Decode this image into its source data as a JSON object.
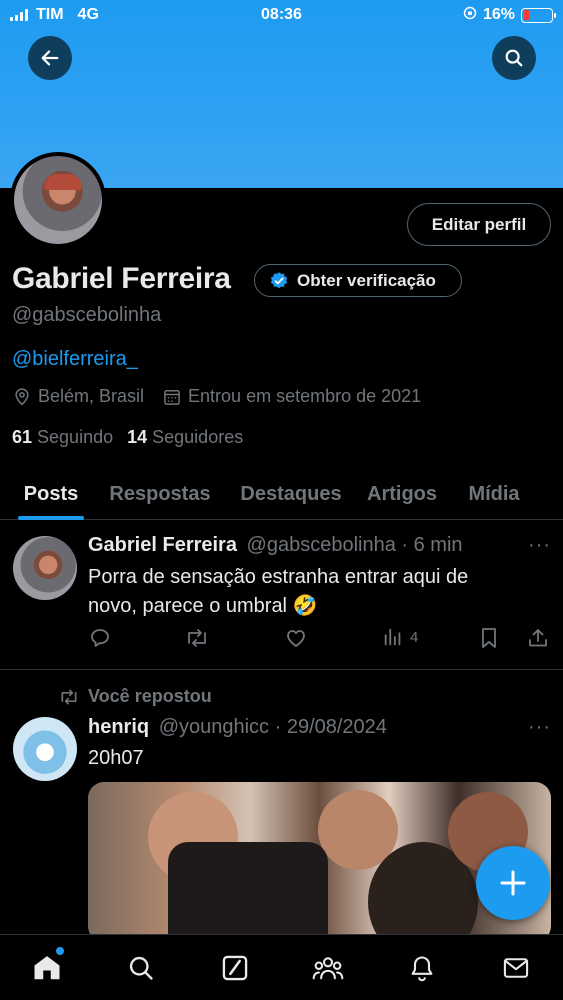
{
  "status_bar": {
    "carrier": "TIM",
    "network": "4G",
    "time": "08:36",
    "battery": "16%"
  },
  "profile": {
    "name": "Gabriel Ferreira",
    "verification_label": "Obter verificação",
    "handle": "@gabscebolinha",
    "bio": "@bielferreira_",
    "location": "Belém, Brasil",
    "joined": "Entrou em setembro de 2021",
    "following_count": "61",
    "following_label": "Seguindo",
    "followers_count": "14",
    "followers_label": "Seguidores",
    "edit_label": "Editar perfil"
  },
  "tabs": [
    {
      "label": "Posts",
      "active": true
    },
    {
      "label": "Respostas",
      "active": false
    },
    {
      "label": "Destaques",
      "active": false
    },
    {
      "label": "Artigos",
      "active": false
    },
    {
      "label": "Mídia",
      "active": false
    }
  ],
  "posts": [
    {
      "author": "Gabriel Ferreira",
      "handle_time": "@gabscebolinha · 6 min",
      "text_line1": "Porra de sensação estranha entrar aqui de",
      "text_line2": "novo, parece o umbral 🤣",
      "views": "4",
      "more": "···"
    },
    {
      "repost_label": "Você repostou",
      "author": "henriq",
      "handle_time": "@younghicc · 29/08/2024",
      "text": "20h07",
      "more": "···"
    }
  ],
  "colors": {
    "accent": "#1d9bf0",
    "background": "#000000",
    "muted": "#71767b",
    "text": "#e7e9ea"
  }
}
